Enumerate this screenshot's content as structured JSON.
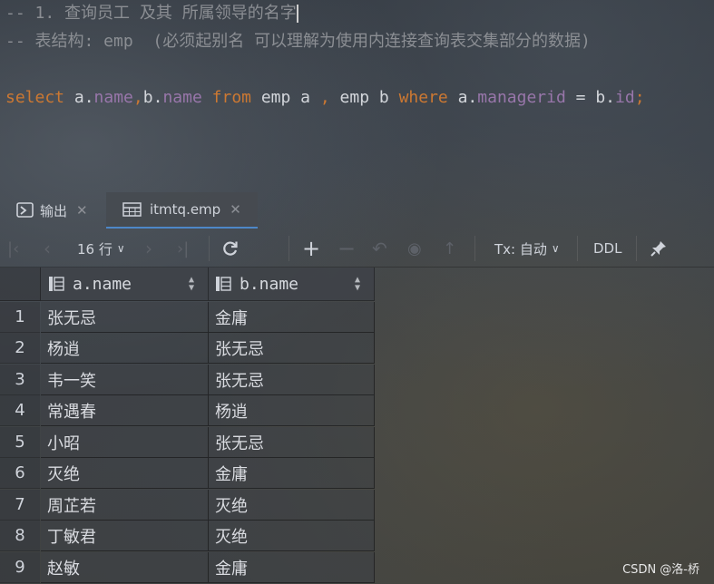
{
  "editor": {
    "comment1": "-- 1. 查询员工 及其 所属领导的名字",
    "comment2": "-- 表结构: emp  (必须起别名 可以理解为使用内连接查询表交集部分的数据)",
    "sql": {
      "select": "select",
      "a1": " a.",
      "name1": "name",
      "comma1": ",",
      "b1": "b.",
      "name2": "name",
      "sp1": " ",
      "from": "from",
      "emp1": " emp a ",
      "comma2": ",",
      "emp2": " emp b ",
      "where": "where",
      "a2": " a.",
      "managerid": "managerid",
      "eq": " = b.",
      "id": "id",
      "semi": ";"
    }
  },
  "tabs": [
    {
      "label": "输出",
      "icon": "console-icon",
      "close": "✕"
    },
    {
      "label": "itmtq.emp",
      "icon": "table-icon",
      "close": "✕"
    }
  ],
  "toolbar": {
    "rows_label": "16 行",
    "tx_label": "Tx: 自动",
    "ddl_label": "DDL"
  },
  "grid": {
    "columns": [
      "a.name",
      "b.name"
    ],
    "rows": [
      {
        "n": "1",
        "a": "张无忌",
        "b": "金庸"
      },
      {
        "n": "2",
        "a": "杨逍",
        "b": "张无忌"
      },
      {
        "n": "3",
        "a": "韦一笑",
        "b": "张无忌"
      },
      {
        "n": "4",
        "a": "常遇春",
        "b": "杨逍"
      },
      {
        "n": "5",
        "a": "小昭",
        "b": "张无忌"
      },
      {
        "n": "6",
        "a": "灭绝",
        "b": "金庸"
      },
      {
        "n": "7",
        "a": "周芷若",
        "b": "灭绝"
      },
      {
        "n": "8",
        "a": "丁敏君",
        "b": "灭绝"
      },
      {
        "n": "9",
        "a": "赵敏",
        "b": "金庸"
      }
    ]
  },
  "watermark": "CSDN @洛-桥"
}
